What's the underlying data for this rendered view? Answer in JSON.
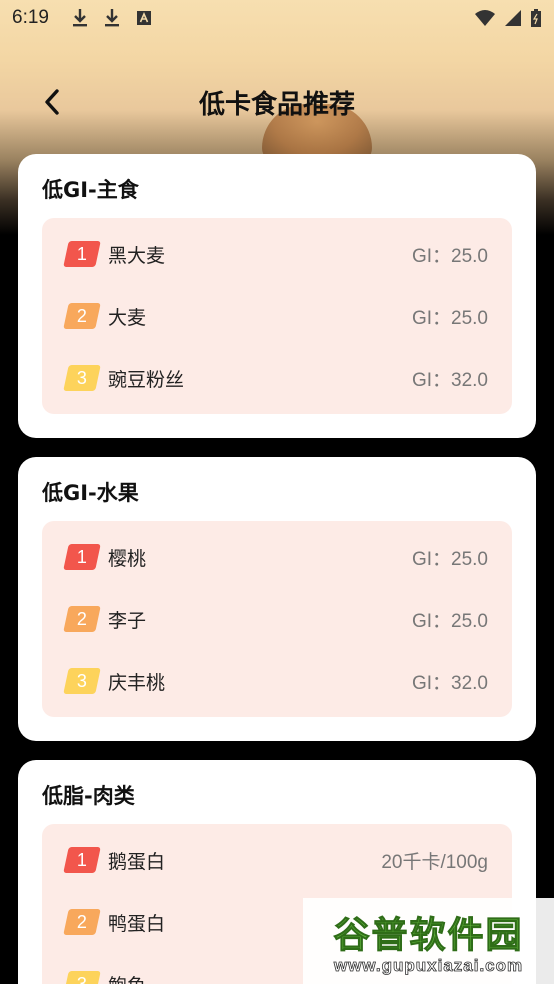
{
  "status_bar": {
    "time": "6:19",
    "notification_icons": [
      "download-icon",
      "download-icon",
      "text-a-icon"
    ],
    "system_icons": [
      "wifi-icon",
      "signal-icon",
      "battery-icon"
    ]
  },
  "header": {
    "back_icon": "chevron-left-icon",
    "title": "低卡食品推荐"
  },
  "sections": [
    {
      "title": "低GI-主食",
      "items": [
        {
          "rank": "1",
          "name": "黑大麦",
          "value": "GI：25.0"
        },
        {
          "rank": "2",
          "name": "大麦",
          "value": "GI：25.0"
        },
        {
          "rank": "3",
          "name": "豌豆粉丝",
          "value": "GI：32.0"
        }
      ]
    },
    {
      "title": "低GI-水果",
      "items": [
        {
          "rank": "1",
          "name": "樱桃",
          "value": "GI：25.0"
        },
        {
          "rank": "2",
          "name": "李子",
          "value": "GI：25.0"
        },
        {
          "rank": "3",
          "name": "庆丰桃",
          "value": "GI：32.0"
        }
      ]
    },
    {
      "title": "低脂-肉类",
      "items": [
        {
          "rank": "1",
          "name": "鹅蛋白",
          "value": "20千卡/100g"
        },
        {
          "rank": "2",
          "name": "鸭蛋白",
          "value": ""
        },
        {
          "rank": "3",
          "name": "鲍鱼",
          "value": ""
        }
      ]
    }
  ],
  "watermark": {
    "brand": "谷普软件园",
    "url": "www.gupuxiazai.com"
  },
  "colors": {
    "rank1": "#f2564c",
    "rank2": "#f8a85c",
    "rank3": "#fdd35b",
    "list_bg": "#fdebe6",
    "card_bg": "#ffffff"
  }
}
